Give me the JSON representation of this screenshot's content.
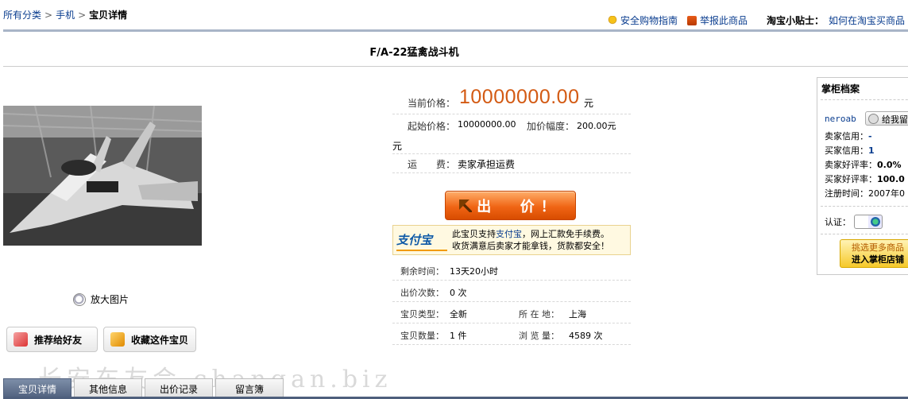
{
  "breadcrumb": {
    "items": [
      "所有分类",
      "手机"
    ],
    "current": "宝贝详情",
    "separator": ">"
  },
  "top_links": {
    "safety_guide": "安全购物指南",
    "report": "举报此商品",
    "tips_label": "淘宝小贴士：",
    "tips_link": "如何在淘宝买商品"
  },
  "product": {
    "title": "F/A-22猛禽战斗机",
    "zoom_label": "放大图片"
  },
  "actions": {
    "recommend": "推荐给好友",
    "favorite": "收藏这件宝贝",
    "bid": "出  价！"
  },
  "pricing": {
    "current_label": "当前价格：",
    "current_value": "10000000.00",
    "current_unit": "元",
    "start_label": "起始价格：",
    "start_value": "10000000.00",
    "increment_label": "加价幅度：",
    "increment_value": "200.00元",
    "increment_wrap": "元",
    "shipping_label": "运　　费：",
    "shipping_value": "卖家承担运费"
  },
  "alipay": {
    "logo": "支付宝",
    "line1_pre": "此宝贝支持",
    "line1_link": "支付宝",
    "line1_post": "，网上汇款免手续费。",
    "line2": "收货满意后卖家才能拿钱，货款都安全！"
  },
  "info": {
    "remaining_label": "剩余时间：",
    "remaining_value": "13天20小时",
    "bids_label": "出价次数：",
    "bids_value": "0 次",
    "type_label": "宝贝类型：",
    "type_value": "全新",
    "location_label": "所 在 地：",
    "location_value": "上海",
    "quantity_label": "宝贝数量：",
    "quantity_value": "1 件",
    "views_label": "浏 览 量：",
    "views_value": "4589 次"
  },
  "shopkeeper": {
    "title": "掌柜档案",
    "name": "neroab",
    "message_btn": "给我留",
    "seller_credit_label": "卖家信用：",
    "seller_credit_value": "-",
    "buyer_credit_label": "买家信用：",
    "buyer_credit_value": "1",
    "seller_rate_label": "卖家好评率：",
    "seller_rate_value": "0.0%",
    "buyer_rate_label": "买家好评率：",
    "buyer_rate_value": "100.0",
    "register_label": "注册时间：",
    "register_value": "2007年0",
    "cert_label": "认证：",
    "shop_line1": "挑选更多商品",
    "shop_line2": "进入掌柜店铺"
  },
  "tabs": [
    "宝贝详情",
    "其他信息",
    "出价记录",
    "留言簿"
  ],
  "watermark": "长安车友会 changan.biz",
  "colors": {
    "price": "#d35a13",
    "link": "#0a3d8f",
    "tab_active": "#4e5f7c",
    "bid_button": "#f06515"
  }
}
